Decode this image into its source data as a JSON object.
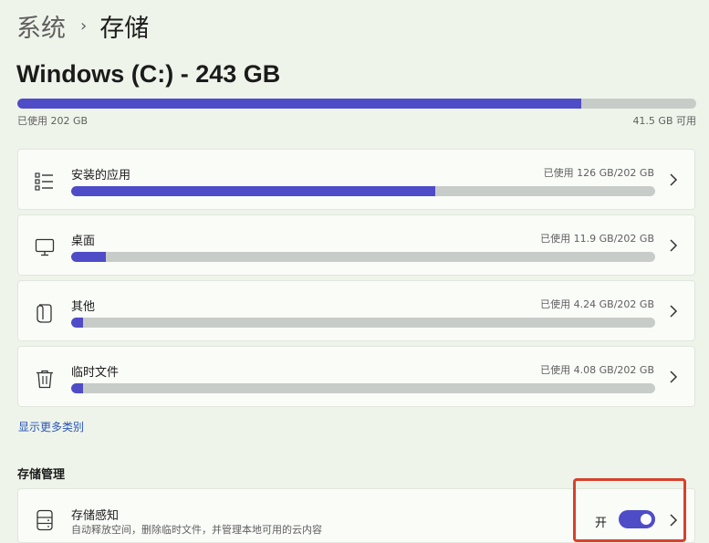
{
  "breadcrumb": {
    "parent": "系统",
    "separator": "›",
    "current": "存储"
  },
  "drive": {
    "title": "Windows (C:) - 243 GB",
    "used_label": "已使用 202 GB",
    "free_label": "41.5 GB 可用",
    "used_fraction": 0.831
  },
  "categories": [
    {
      "label": "安装的应用",
      "usage": "已使用 126 GB/202 GB",
      "fraction": 0.624,
      "icon": "list-icon"
    },
    {
      "label": "桌面",
      "usage": "已使用 11.9 GB/202 GB",
      "fraction": 0.059,
      "icon": "monitor-icon"
    },
    {
      "label": "其他",
      "usage": "已使用 4.24 GB/202 GB",
      "fraction": 0.021,
      "icon": "document-icon"
    },
    {
      "label": "临时文件",
      "usage": "已使用 4.08 GB/202 GB",
      "fraction": 0.02,
      "icon": "trash-icon"
    }
  ],
  "show_more_label": "显示更多类别",
  "storage_management": {
    "title": "存储管理",
    "storage_sense": {
      "label": "存储感知",
      "description": "自动释放空间，删除临时文件，并管理本地可用的云内容",
      "state": "开",
      "enabled": true,
      "icon": "drive-icon"
    }
  },
  "colors": {
    "accent": "#4f4cc8",
    "background": "#eef4ea",
    "highlight": "#d8412c"
  }
}
